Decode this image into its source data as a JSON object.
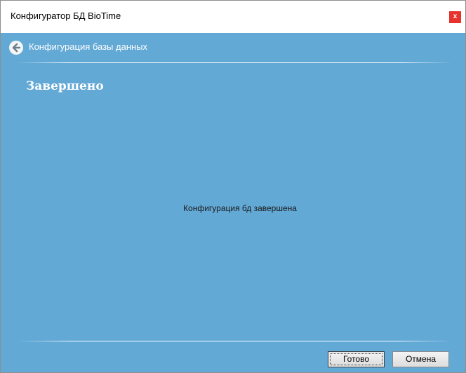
{
  "window": {
    "title": "Конфигуратор БД BioTime",
    "close_label": "x"
  },
  "nav": {
    "back_icon": "arrow-left-circle-icon",
    "title": "Конфигурация базы данных"
  },
  "page": {
    "title": "Завершено",
    "message": "Конфигурация бд завершена"
  },
  "buttons": {
    "done_label": "Готово",
    "cancel_label": "Отмена"
  },
  "colors": {
    "background": "#63a9d6",
    "close_button": "#e7322d"
  }
}
